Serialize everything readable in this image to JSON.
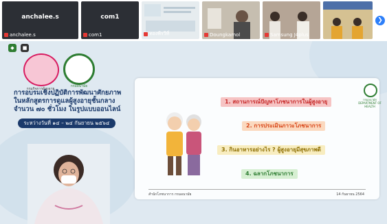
{
  "participants": [
    {
      "name": "anchalee.s",
      "label": "anchalee.s"
    },
    {
      "name": "com1",
      "label": "com1"
    },
    {
      "label": "ทองพีรวีที่"
    },
    {
      "label": "Doungkamol"
    },
    {
      "label": "Samsung J4plus"
    },
    {
      "label": ""
    }
  ],
  "header": {
    "logo1_caption": "กรมกิจการผู้สูงอายุ",
    "logo2_caption": "กรมอนามัย",
    "title_lines": [
      "การอบรมเชิงปฏิบัติการพัฒนาศักยภาพ",
      "ในหลักสูตรการดูแลผู้สูงอายุชั้นกลาง",
      "จำนวน ๗๐ ชั่วโมง ในรูปแบบออนไลน์"
    ],
    "date_range": "ระหว่างวันที่ ๑๔ – ๒๔ กันยายน ๒๕๖๔"
  },
  "slide": {
    "logo_caption": "กรมอนามัย DEPARTMENT OF HEALTH",
    "topics": [
      "1. สถานการณ์ปัญหาโภชนาการในผู้สูงอายุ",
      "2. การประเมินภาวะโภชนาการ",
      "3. กินอาหารอย่างไร ? ผู้สูงอายุมีสุขภาพดี",
      "4. ฉลากโภชนาการ"
    ],
    "footer_left": "สำนักโภชนาการ กรมอนามัย",
    "footer_right": "14 กันยายน 2564"
  },
  "colors": {
    "accent": "#2d7ff9",
    "navy": "#1b3a6b",
    "green": "#2e7d32"
  }
}
